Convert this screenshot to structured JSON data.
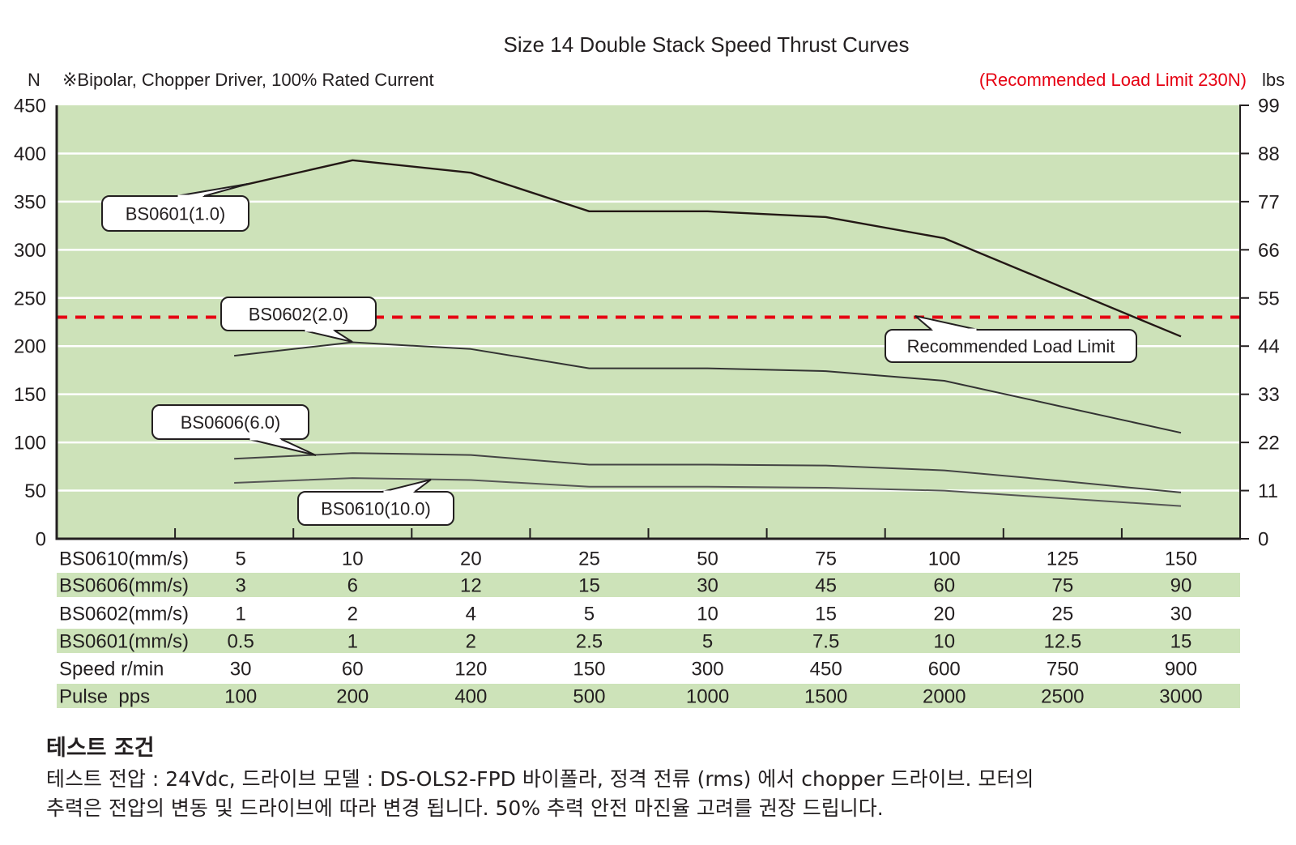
{
  "chart_data": {
    "type": "line",
    "title": "Size 14 Double Stack Speed Thrust Curves",
    "subtitle": "※Bipolar, Chopper Driver, 100% Rated Current",
    "ylabel": "N",
    "ylabel_right": "lbs",
    "ylim": [
      0,
      450
    ],
    "yticks": [
      0,
      50,
      100,
      150,
      200,
      250,
      300,
      350,
      400,
      450
    ],
    "yticks_right": [
      0,
      11,
      22,
      33,
      44,
      55,
      66,
      77,
      88,
      99
    ],
    "grid": true,
    "categories": [
      "5",
      "10",
      "20",
      "25",
      "50",
      "75",
      "100",
      "125",
      "150"
    ],
    "xlabel": "BS0610(mm/s)",
    "series": [
      {
        "name": "BS0601(1.0)",
        "color": "#231815",
        "values": [
          365,
          393,
          380,
          340,
          340,
          334,
          312,
          261,
          210
        ]
      },
      {
        "name": "BS0602(2.0)",
        "color": "#333333",
        "values": [
          190,
          204,
          197,
          177,
          177,
          174,
          164,
          137,
          110
        ]
      },
      {
        "name": "BS0606(6.0)",
        "color": "#444444",
        "values": [
          83,
          89,
          87,
          77,
          77,
          76,
          71,
          60,
          48
        ]
      },
      {
        "name": "BS0610(10.0)",
        "color": "#555555",
        "values": [
          58,
          63,
          61,
          54,
          54,
          53,
          50,
          42,
          34
        ]
      }
    ],
    "reference_line": {
      "label": "Recommended Load Limit",
      "value": 230,
      "color": "#e60012",
      "note": "(Recommended Load Limit 230N)"
    },
    "colors": {
      "plot_background": "#cde2b9",
      "table_band": "#cde3b9",
      "gridline": "#ffffff"
    },
    "table": {
      "rows": [
        {
          "label": "BS0610(mm/s)",
          "values": [
            "5",
            "10",
            "20",
            "25",
            "50",
            "75",
            "100",
            "125",
            "150"
          ]
        },
        {
          "label": "BS0606(mm/s)",
          "values": [
            "3",
            "6",
            "12",
            "15",
            "30",
            "45",
            "60",
            "75",
            "90"
          ]
        },
        {
          "label": "BS0602(mm/s)",
          "values": [
            "1",
            "2",
            "4",
            "5",
            "10",
            "15",
            "20",
            "25",
            "30"
          ]
        },
        {
          "label": "BS0601(mm/s)",
          "values": [
            "0.5",
            "1",
            "2",
            "2.5",
            "5",
            "7.5",
            "10",
            "12.5",
            "15"
          ]
        },
        {
          "label": "Speed r/min",
          "values": [
            "30",
            "60",
            "120",
            "150",
            "300",
            "450",
            "600",
            "750",
            "900"
          ]
        },
        {
          "label": "Pulse  pps",
          "values": [
            "100",
            "200",
            "400",
            "500",
            "1000",
            "1500",
            "2000",
            "2500",
            "3000"
          ]
        }
      ]
    }
  },
  "notes": {
    "heading": "테스트 조건",
    "lines": [
      "테스트 전압 : 24Vdc, 드라이브 모델 : DS-OLS2-FPD 바이폴라, 정격 전류 (rms) 에서 chopper 드라이브. 모터의",
      "추력은 전압의 변동 및 드라이브에 따라 변경 됩니다. 50% 추력 안전 마진율 고려를 권장 드립니다."
    ]
  }
}
